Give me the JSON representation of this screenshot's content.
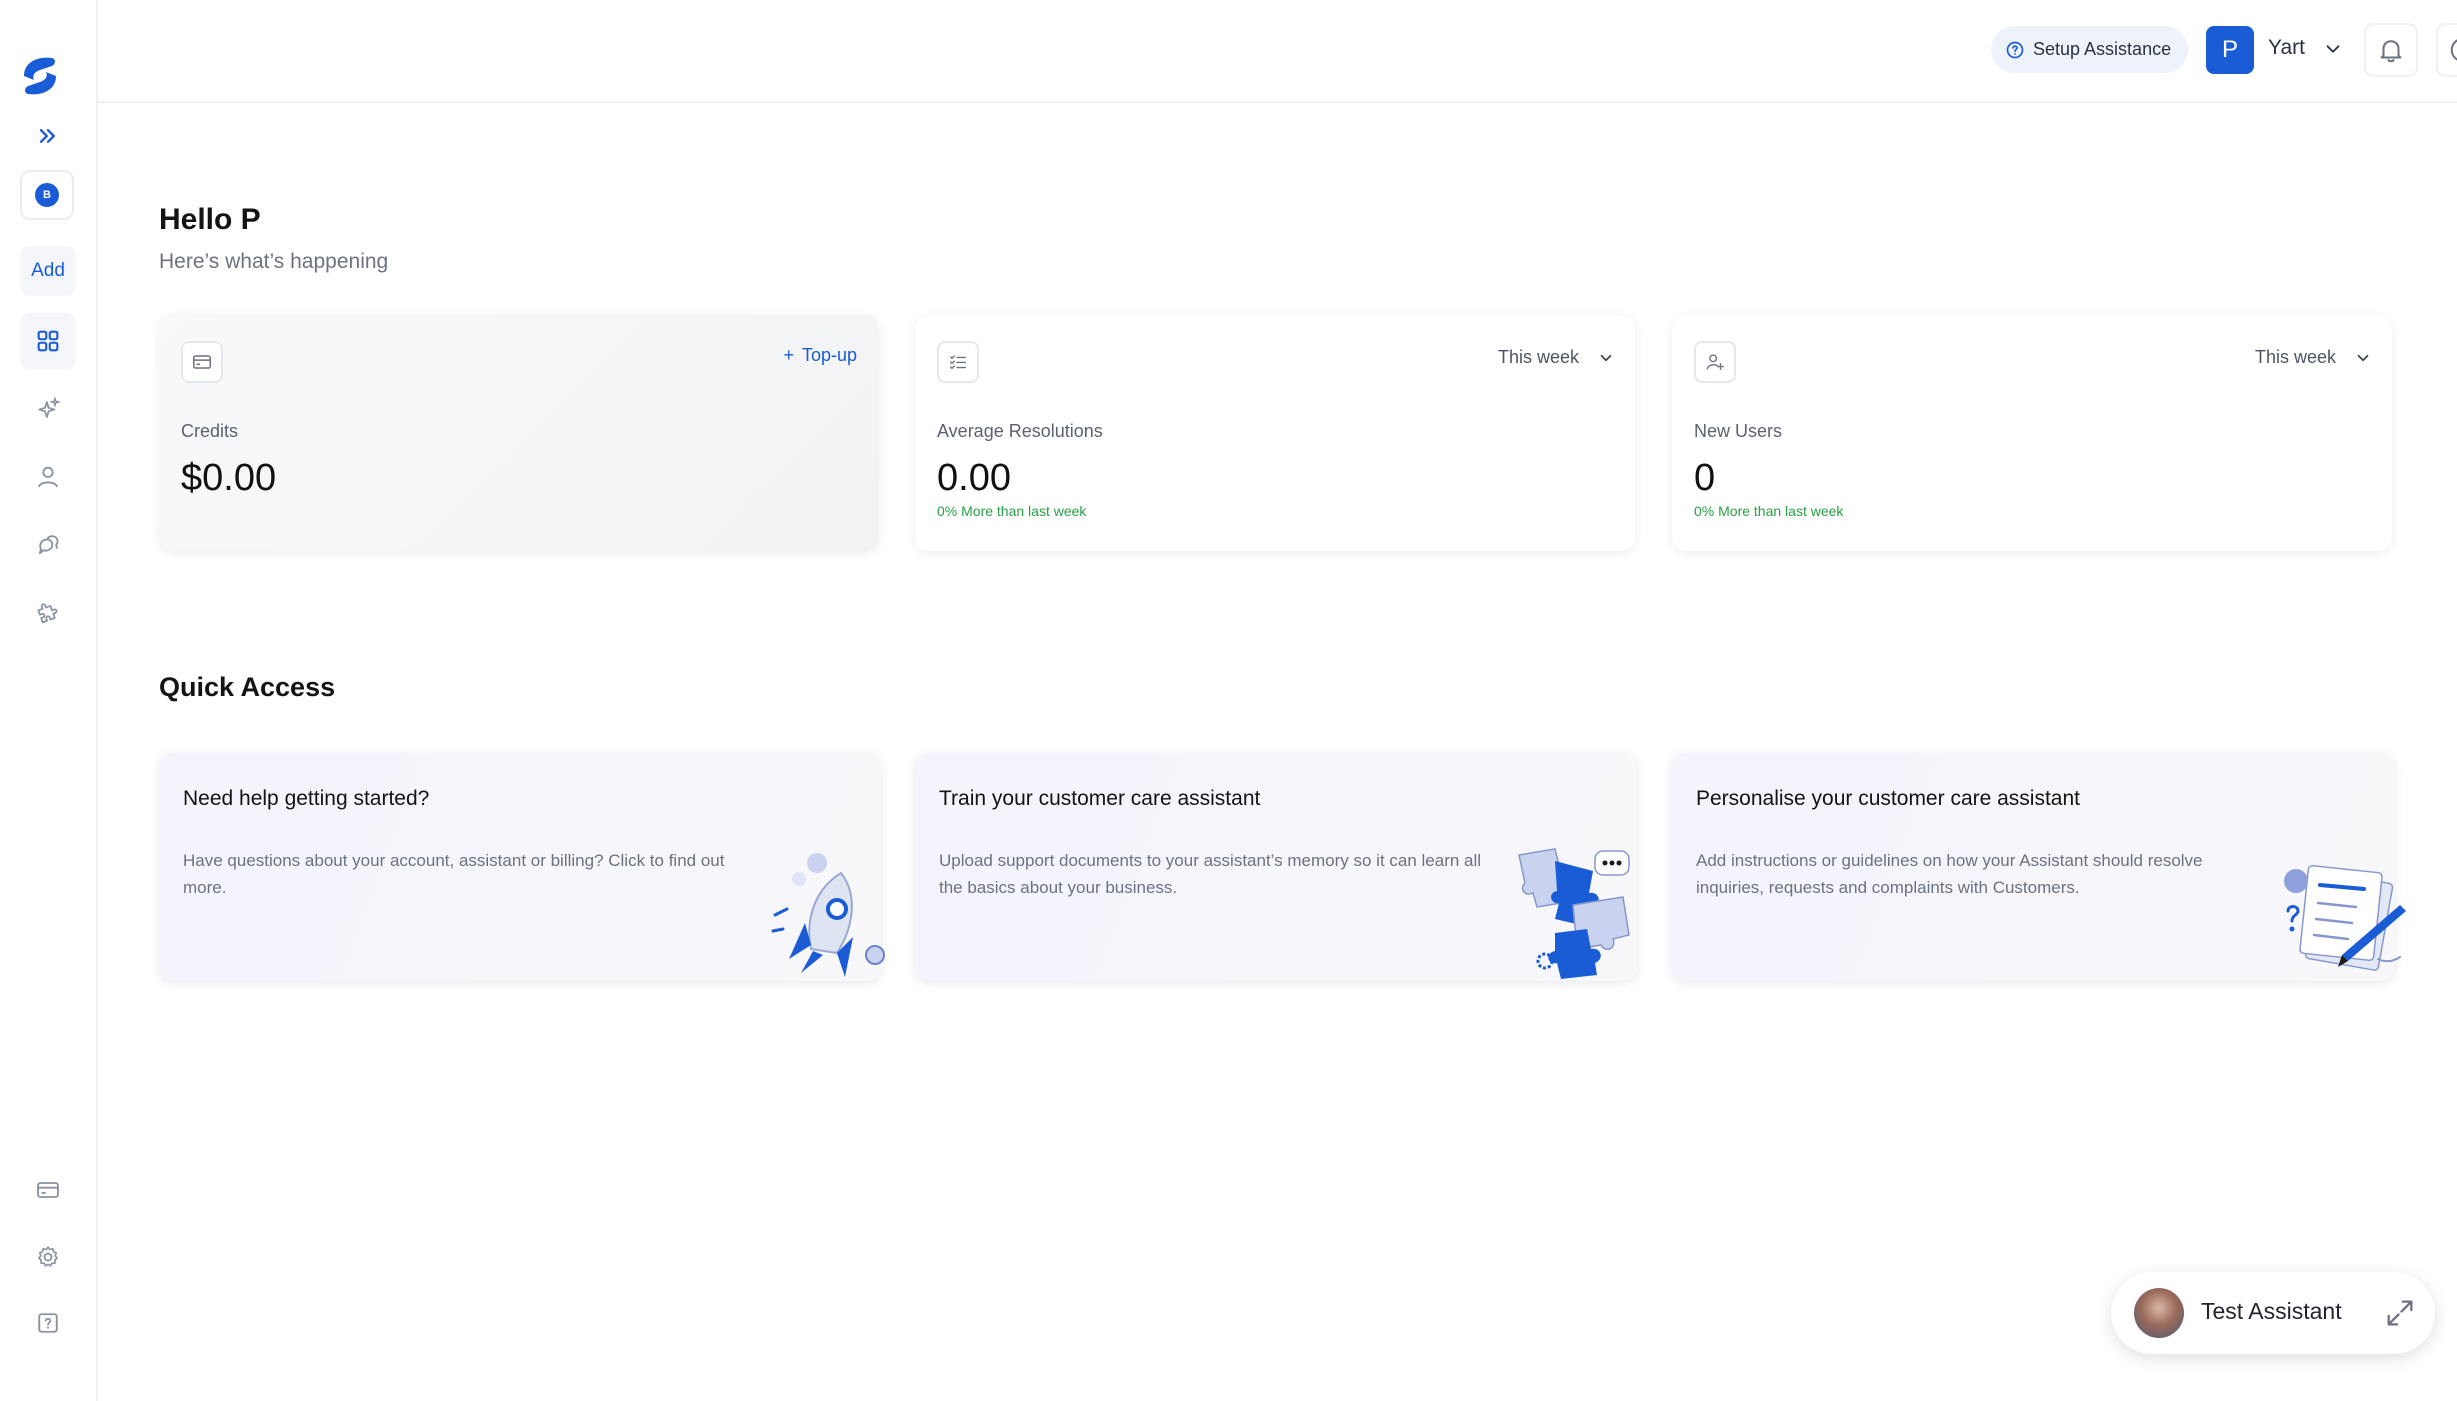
{
  "sidebar": {
    "logo": "brand-logo",
    "expand_icon": "double-chevron-right-icon",
    "badge_letter": "B",
    "add_label": "Add",
    "nav_icons": [
      "dashboard-grid-icon",
      "sparkle-icon",
      "user-icon",
      "chat-bubbles-icon",
      "puzzle-icon"
    ],
    "bottom_icons": [
      "credit-card-icon",
      "gear-icon",
      "help-square-icon"
    ]
  },
  "header": {
    "setup_label": "Setup Assistance",
    "avatar_letter": "P",
    "user_name": "Yart"
  },
  "greeting": {
    "title": "Hello P",
    "subtitle": "Here’s what’s happening"
  },
  "stats": {
    "credits": {
      "label": "Credits",
      "value": "$0.00",
      "action": "Top-up"
    },
    "resolutions": {
      "label": "Average Resolutions",
      "value": "0.00",
      "change": "0% More than last week",
      "period": "This week"
    },
    "users": {
      "label": "New Users",
      "value": "0",
      "change": "0% More than last week",
      "period": "This week"
    }
  },
  "quick_access": {
    "title": "Quick Access",
    "cards": [
      {
        "title": "Need help getting started?",
        "body": "Have questions about your account, assistant or billing? Click to find out more."
      },
      {
        "title": "Train your customer care assistant",
        "body": "Upload support documents to your assistant’s memory so it can learn all the basics about your business."
      },
      {
        "title": "Personalise your customer care assistant",
        "body": "Add instructions or guidelines on how your Assistant should resolve inquiries, requests and complaints with Customers."
      }
    ]
  },
  "assistant": {
    "name": "Test Assistant"
  },
  "colors": {
    "accent": "#1a5bd6",
    "positive": "#27a046",
    "muted": "#6b7280"
  }
}
